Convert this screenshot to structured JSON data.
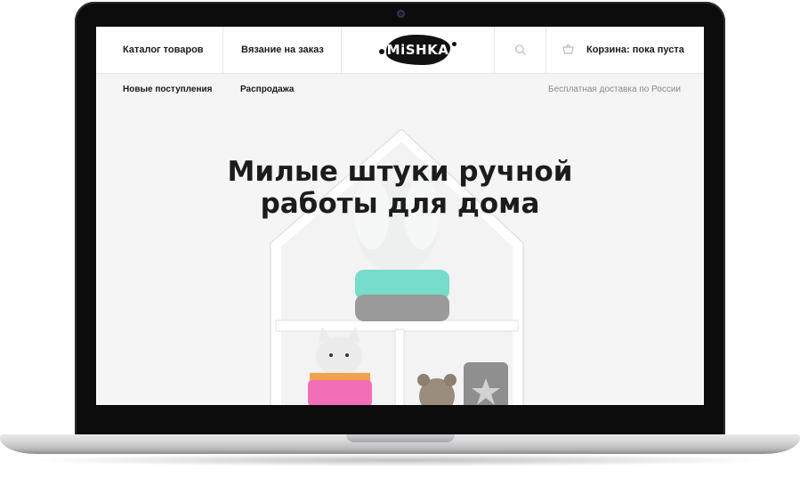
{
  "header": {
    "nav": [
      {
        "label": "Каталог товаров"
      },
      {
        "label": "Вязание на заказ"
      }
    ],
    "logo_text": "MiSHKA",
    "cart_label": "Корзина: пока пуста"
  },
  "subnav": {
    "items": [
      {
        "label": "Новые поступления"
      },
      {
        "label": "Распродажа"
      }
    ],
    "delivery_note": "Бесплатная доставка по России"
  },
  "hero": {
    "title_line1": "Милые штуки ручной",
    "title_line2": "работы для дома"
  },
  "icons": {
    "search": "search-icon",
    "cart": "basket-icon"
  },
  "colors": {
    "accent_mint": "#6fd8c4",
    "accent_pink": "#f06bb4",
    "text_dark": "#1a1a1a"
  }
}
